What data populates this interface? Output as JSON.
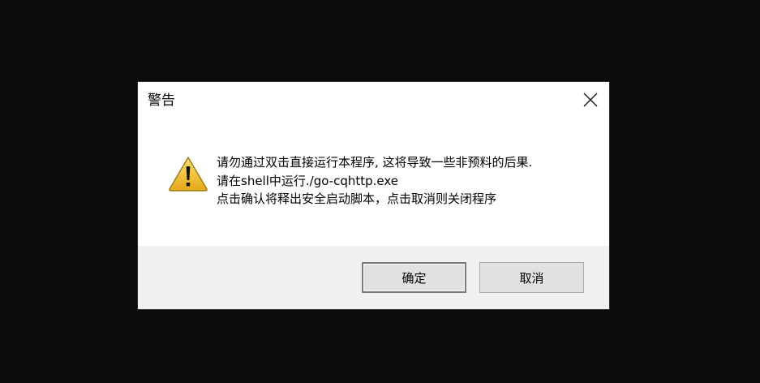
{
  "dialog": {
    "title": "警告",
    "close_icon": "close-icon",
    "warning_icon": "warning-triangle-icon",
    "message_lines": [
      "请勿通过双击直接运行本程序, 这将导致一些非预料的后果.",
      "请在shell中运行./go-cqhttp.exe",
      "点击确认将释出安全启动脚本，点击取消则关闭程序"
    ],
    "buttons": {
      "ok_label": "确定",
      "cancel_label": "取消"
    }
  },
  "colors": {
    "backdrop": "#0c0c0c",
    "dialog_bg": "#ffffff",
    "footer_bg": "#f0f0f0",
    "warning_yellow": "#f4c430"
  }
}
